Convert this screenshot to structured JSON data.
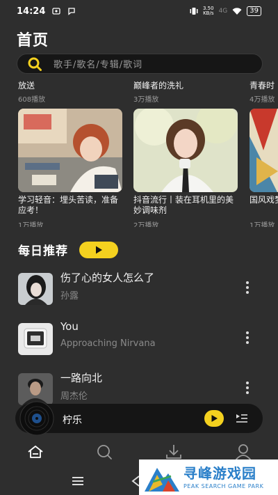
{
  "status_bar": {
    "time": "14:24",
    "net_speed_value": "3.50",
    "net_speed_unit": "KB/s",
    "network": "4G",
    "battery": "39"
  },
  "header": {
    "title": "首页"
  },
  "search": {
    "placeholder": "歌手/歌名/专辑/歌词"
  },
  "prev_playlists": [
    {
      "title": "放送",
      "plays": "608播放"
    },
    {
      "title": "巅峰者的洗礼",
      "plays": "3万播放"
    },
    {
      "title": "青春时",
      "plays": "4万播放"
    }
  ],
  "playlists": [
    {
      "title": "学习轻音：埋头苦读，准备应考！",
      "plays": "1万播放"
    },
    {
      "title": "抖音流行丨装在耳机里的美妙调味剂",
      "plays": "2万播放"
    },
    {
      "title": "国风戏梦淡红",
      "plays": "1万播放"
    }
  ],
  "daily": {
    "title": "每日推荐"
  },
  "songs": [
    {
      "name": "伤了心的女人怎么了",
      "artist": "孙露"
    },
    {
      "name": "You",
      "artist": "Approaching Nirvana"
    },
    {
      "name": "一路向北",
      "artist": "周杰伦"
    }
  ],
  "mini_player": {
    "now_playing": "柠乐"
  },
  "tabs": [
    {
      "icon": "home-icon"
    },
    {
      "icon": "search-icon"
    },
    {
      "icon": "download-icon"
    },
    {
      "icon": "user-icon"
    }
  ],
  "watermark": {
    "title": "寻峰游戏园",
    "subtitle": "PEAK SEARCH GAME PARK"
  },
  "colors": {
    "accent": "#f4d11f",
    "background": "#2e2e2e",
    "search_bg": "#161616"
  }
}
